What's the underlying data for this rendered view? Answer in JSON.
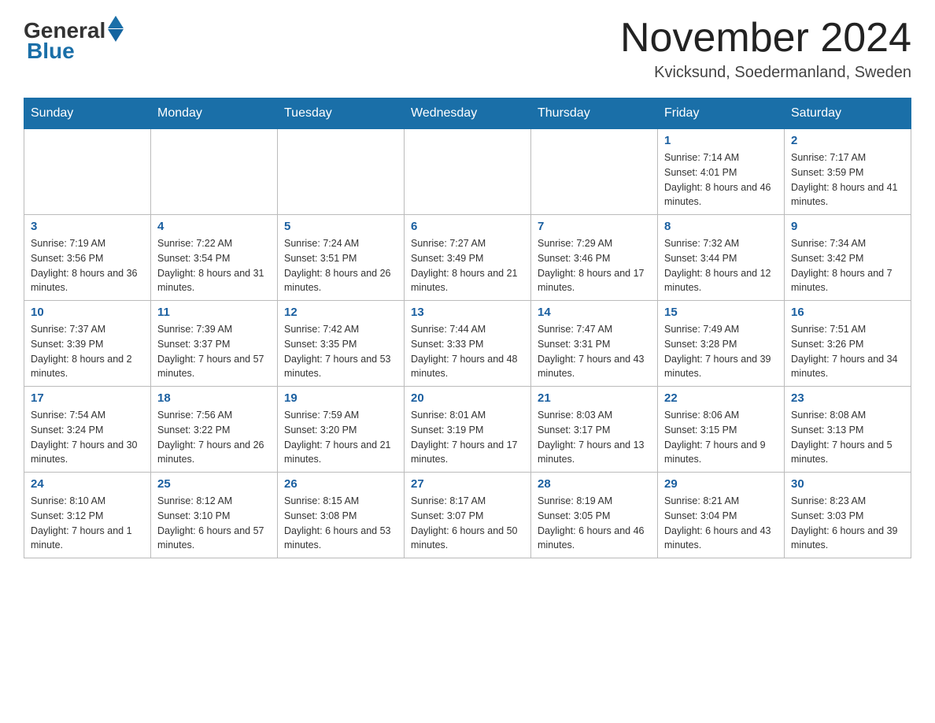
{
  "header": {
    "logo_general": "General",
    "logo_blue": "Blue",
    "month_title": "November 2024",
    "location": "Kvicksund, Soedermanland, Sweden"
  },
  "days_of_week": [
    "Sunday",
    "Monday",
    "Tuesday",
    "Wednesday",
    "Thursday",
    "Friday",
    "Saturday"
  ],
  "weeks": [
    [
      {
        "day": "",
        "info": ""
      },
      {
        "day": "",
        "info": ""
      },
      {
        "day": "",
        "info": ""
      },
      {
        "day": "",
        "info": ""
      },
      {
        "day": "",
        "info": ""
      },
      {
        "day": "1",
        "info": "Sunrise: 7:14 AM\nSunset: 4:01 PM\nDaylight: 8 hours and 46 minutes."
      },
      {
        "day": "2",
        "info": "Sunrise: 7:17 AM\nSunset: 3:59 PM\nDaylight: 8 hours and 41 minutes."
      }
    ],
    [
      {
        "day": "3",
        "info": "Sunrise: 7:19 AM\nSunset: 3:56 PM\nDaylight: 8 hours and 36 minutes."
      },
      {
        "day": "4",
        "info": "Sunrise: 7:22 AM\nSunset: 3:54 PM\nDaylight: 8 hours and 31 minutes."
      },
      {
        "day": "5",
        "info": "Sunrise: 7:24 AM\nSunset: 3:51 PM\nDaylight: 8 hours and 26 minutes."
      },
      {
        "day": "6",
        "info": "Sunrise: 7:27 AM\nSunset: 3:49 PM\nDaylight: 8 hours and 21 minutes."
      },
      {
        "day": "7",
        "info": "Sunrise: 7:29 AM\nSunset: 3:46 PM\nDaylight: 8 hours and 17 minutes."
      },
      {
        "day": "8",
        "info": "Sunrise: 7:32 AM\nSunset: 3:44 PM\nDaylight: 8 hours and 12 minutes."
      },
      {
        "day": "9",
        "info": "Sunrise: 7:34 AM\nSunset: 3:42 PM\nDaylight: 8 hours and 7 minutes."
      }
    ],
    [
      {
        "day": "10",
        "info": "Sunrise: 7:37 AM\nSunset: 3:39 PM\nDaylight: 8 hours and 2 minutes."
      },
      {
        "day": "11",
        "info": "Sunrise: 7:39 AM\nSunset: 3:37 PM\nDaylight: 7 hours and 57 minutes."
      },
      {
        "day": "12",
        "info": "Sunrise: 7:42 AM\nSunset: 3:35 PM\nDaylight: 7 hours and 53 minutes."
      },
      {
        "day": "13",
        "info": "Sunrise: 7:44 AM\nSunset: 3:33 PM\nDaylight: 7 hours and 48 minutes."
      },
      {
        "day": "14",
        "info": "Sunrise: 7:47 AM\nSunset: 3:31 PM\nDaylight: 7 hours and 43 minutes."
      },
      {
        "day": "15",
        "info": "Sunrise: 7:49 AM\nSunset: 3:28 PM\nDaylight: 7 hours and 39 minutes."
      },
      {
        "day": "16",
        "info": "Sunrise: 7:51 AM\nSunset: 3:26 PM\nDaylight: 7 hours and 34 minutes."
      }
    ],
    [
      {
        "day": "17",
        "info": "Sunrise: 7:54 AM\nSunset: 3:24 PM\nDaylight: 7 hours and 30 minutes."
      },
      {
        "day": "18",
        "info": "Sunrise: 7:56 AM\nSunset: 3:22 PM\nDaylight: 7 hours and 26 minutes."
      },
      {
        "day": "19",
        "info": "Sunrise: 7:59 AM\nSunset: 3:20 PM\nDaylight: 7 hours and 21 minutes."
      },
      {
        "day": "20",
        "info": "Sunrise: 8:01 AM\nSunset: 3:19 PM\nDaylight: 7 hours and 17 minutes."
      },
      {
        "day": "21",
        "info": "Sunrise: 8:03 AM\nSunset: 3:17 PM\nDaylight: 7 hours and 13 minutes."
      },
      {
        "day": "22",
        "info": "Sunrise: 8:06 AM\nSunset: 3:15 PM\nDaylight: 7 hours and 9 minutes."
      },
      {
        "day": "23",
        "info": "Sunrise: 8:08 AM\nSunset: 3:13 PM\nDaylight: 7 hours and 5 minutes."
      }
    ],
    [
      {
        "day": "24",
        "info": "Sunrise: 8:10 AM\nSunset: 3:12 PM\nDaylight: 7 hours and 1 minute."
      },
      {
        "day": "25",
        "info": "Sunrise: 8:12 AM\nSunset: 3:10 PM\nDaylight: 6 hours and 57 minutes."
      },
      {
        "day": "26",
        "info": "Sunrise: 8:15 AM\nSunset: 3:08 PM\nDaylight: 6 hours and 53 minutes."
      },
      {
        "day": "27",
        "info": "Sunrise: 8:17 AM\nSunset: 3:07 PM\nDaylight: 6 hours and 50 minutes."
      },
      {
        "day": "28",
        "info": "Sunrise: 8:19 AM\nSunset: 3:05 PM\nDaylight: 6 hours and 46 minutes."
      },
      {
        "day": "29",
        "info": "Sunrise: 8:21 AM\nSunset: 3:04 PM\nDaylight: 6 hours and 43 minutes."
      },
      {
        "day": "30",
        "info": "Sunrise: 8:23 AM\nSunset: 3:03 PM\nDaylight: 6 hours and 39 minutes."
      }
    ]
  ]
}
